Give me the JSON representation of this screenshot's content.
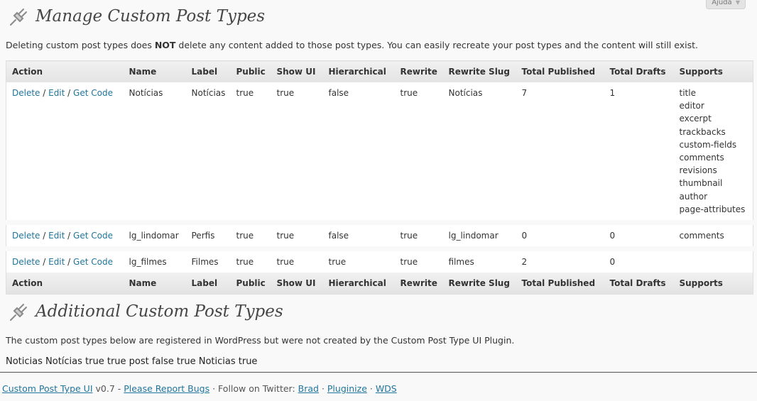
{
  "help_tab": {
    "label": "Ajuda"
  },
  "manage": {
    "title": "Manage Custom Post Types",
    "note_before": "Deleting custom post types does ",
    "note_strong": "NOT",
    "note_after": " delete any content added to those post types. You can easily recreate your post types and the content will still exist."
  },
  "table": {
    "columns": [
      "Action",
      "Name",
      "Label",
      "Public",
      "Show UI",
      "Hierarchical",
      "Rewrite",
      "Rewrite Slug",
      "Total Published",
      "Total Drafts",
      "Supports"
    ],
    "actions": {
      "delete": "Delete",
      "edit": "Edit",
      "get_code": "Get Code",
      "separator": " / "
    },
    "rows": [
      {
        "name": "Notícias",
        "label": "Notícias",
        "public": "true",
        "show_ui": "true",
        "hierarchical": "false",
        "rewrite": "true",
        "rewrite_slug": "Notícias",
        "total_published": "7",
        "total_drafts": "1",
        "supports": [
          "title",
          "editor",
          "excerpt",
          "trackbacks",
          "custom-fields",
          "comments",
          "revisions",
          "thumbnail",
          "author",
          "page-attributes"
        ]
      },
      {
        "name": "lg_lindomar",
        "label": "Perfis",
        "public": "true",
        "show_ui": "true",
        "hierarchical": "false",
        "rewrite": "true",
        "rewrite_slug": "lg_lindomar",
        "total_published": "0",
        "total_drafts": "0",
        "supports": [
          "comments"
        ]
      },
      {
        "name": "lg_filmes",
        "label": "Filmes",
        "public": "true",
        "show_ui": "true",
        "hierarchical": "true",
        "rewrite": "true",
        "rewrite_slug": "filmes",
        "total_published": "2",
        "total_drafts": "0",
        "supports": []
      }
    ]
  },
  "additional": {
    "title": "Additional Custom Post Types",
    "note": "The custom post types below are registered in WordPress but were not created by the Custom Post Type UI Plugin.",
    "line": "Noticias Notícias true true post false true Noticias true"
  },
  "footer": {
    "plugin_link": "Custom Post Type UI",
    "version": " v0.7 - ",
    "bugs_link": "Please Report Bugs",
    "follow": " · Follow on Twitter: ",
    "brad": "Brad",
    "dot1": " · ",
    "pluginize": "Pluginize",
    "dot2": " · ",
    "wds": "WDS"
  },
  "icons": {
    "heading_icon": "plug-icon",
    "help_arrow": "triangle-down-icon"
  },
  "colors": {
    "link": "#21759b",
    "heading": "#464646",
    "background": "#f9f9f9"
  }
}
